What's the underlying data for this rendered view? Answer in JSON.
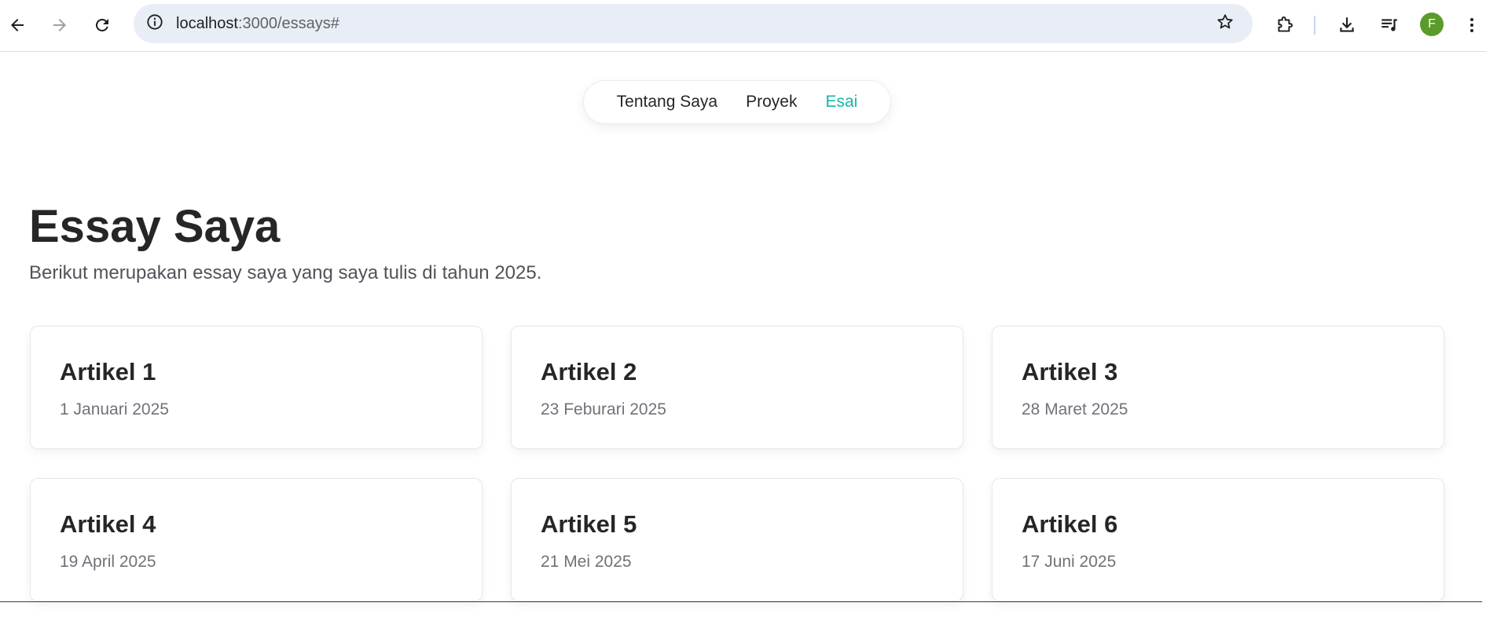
{
  "browser": {
    "url_host": "localhost",
    "url_path": ":3000/essays#",
    "profile_initial": "F",
    "icons": {
      "back": "arrow-left-icon",
      "forward": "arrow-right-icon",
      "reload": "reload-icon",
      "site_info": "info-icon",
      "bookmark": "star-icon",
      "extensions": "puzzle-icon",
      "downloads": "download-icon",
      "media": "playlist-icon",
      "menu": "kebab-menu-icon"
    }
  },
  "nav": {
    "items": [
      {
        "label": "Tentang Saya",
        "active": false
      },
      {
        "label": "Proyek",
        "active": false
      },
      {
        "label": "Esai",
        "active": true
      }
    ],
    "accent_color": "#14b8a6"
  },
  "main": {
    "title": "Essay Saya",
    "subtitle": "Berikut merupakan essay saya yang saya tulis di tahun 2025."
  },
  "articles": [
    {
      "title": "Artikel 1",
      "date": "1 Januari 2025"
    },
    {
      "title": "Artikel 2",
      "date": "23 Feburari 2025"
    },
    {
      "title": "Artikel 3",
      "date": "28 Maret 2025"
    },
    {
      "title": "Artikel 4",
      "date": "19 April 2025"
    },
    {
      "title": "Artikel 5",
      "date": "21 Mei 2025"
    },
    {
      "title": "Artikel 6",
      "date": "17 Juni 2025"
    }
  ]
}
